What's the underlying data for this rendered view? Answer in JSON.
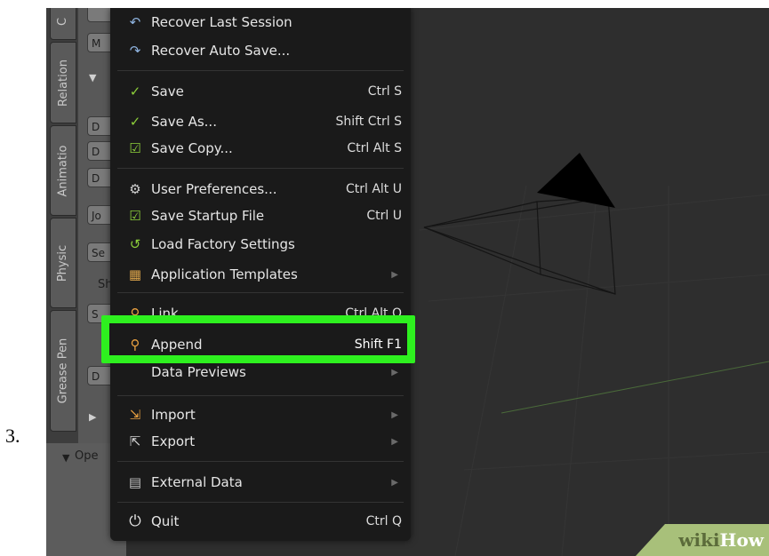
{
  "step_number": "3.",
  "left_panel": {
    "tabs": [
      "C",
      "Relation",
      "Animatio",
      "Physic",
      "Grease Pen"
    ],
    "buttons": [
      "M",
      "D",
      "D",
      "D",
      "Jo",
      "Se",
      "S",
      "D"
    ],
    "labels": [
      "Sh"
    ],
    "bottom_label": "Ope"
  },
  "menu": {
    "items": [
      {
        "label": "Recover Last Session",
        "shortcut": "",
        "icon": "recover-session-icon",
        "glyph": "↶"
      },
      {
        "label": "Recover Auto Save...",
        "shortcut": "",
        "icon": "recover-autosave-icon",
        "glyph": "↷"
      },
      {
        "label": "Save",
        "shortcut": "Ctrl S",
        "icon": "checkmark-icon",
        "glyph": "✓"
      },
      {
        "label": "Save As...",
        "shortcut": "Shift Ctrl S",
        "icon": "save-as-icon",
        "glyph": "✓"
      },
      {
        "label": "Save Copy...",
        "shortcut": "Ctrl Alt S",
        "icon": "save-copy-icon",
        "glyph": "☑"
      },
      {
        "label": "User Preferences...",
        "shortcut": "Ctrl Alt U",
        "icon": "preferences-icon",
        "glyph": "⚙"
      },
      {
        "label": "Save Startup File",
        "shortcut": "Ctrl U",
        "icon": "save-startup-icon",
        "glyph": "☑"
      },
      {
        "label": "Load Factory Settings",
        "shortcut": "",
        "icon": "load-factory-icon",
        "glyph": "↺"
      },
      {
        "label": "Application Templates",
        "shortcut": "",
        "icon": "templates-icon",
        "glyph": "▦",
        "submenu": true
      },
      {
        "label": "Link",
        "shortcut": "Ctrl Alt O",
        "icon": "link-icon",
        "glyph": "⚲"
      },
      {
        "label": "Append",
        "shortcut": "Shift F1",
        "icon": "append-icon",
        "glyph": "⚲"
      },
      {
        "label": "Data Previews",
        "shortcut": "",
        "icon": "",
        "glyph": "",
        "submenu": true
      },
      {
        "label": "Import",
        "shortcut": "",
        "icon": "import-icon",
        "glyph": "⇲",
        "submenu": true
      },
      {
        "label": "Export",
        "shortcut": "",
        "icon": "export-icon",
        "glyph": "⇱",
        "submenu": true
      },
      {
        "label": "External Data",
        "shortcut": "",
        "icon": "external-data-icon",
        "glyph": "▤",
        "submenu": true
      },
      {
        "label": "Quit",
        "shortcut": "Ctrl Q",
        "icon": "power-icon",
        "glyph": "⏻"
      }
    ],
    "submenu_arrow": "▶"
  },
  "watermark": {
    "wiki": "wiki",
    "how": "How"
  },
  "colors": {
    "highlight": "#2ef01f",
    "menu_bg": "#1a1a1a",
    "viewport_bg": "#2e2e2e"
  }
}
